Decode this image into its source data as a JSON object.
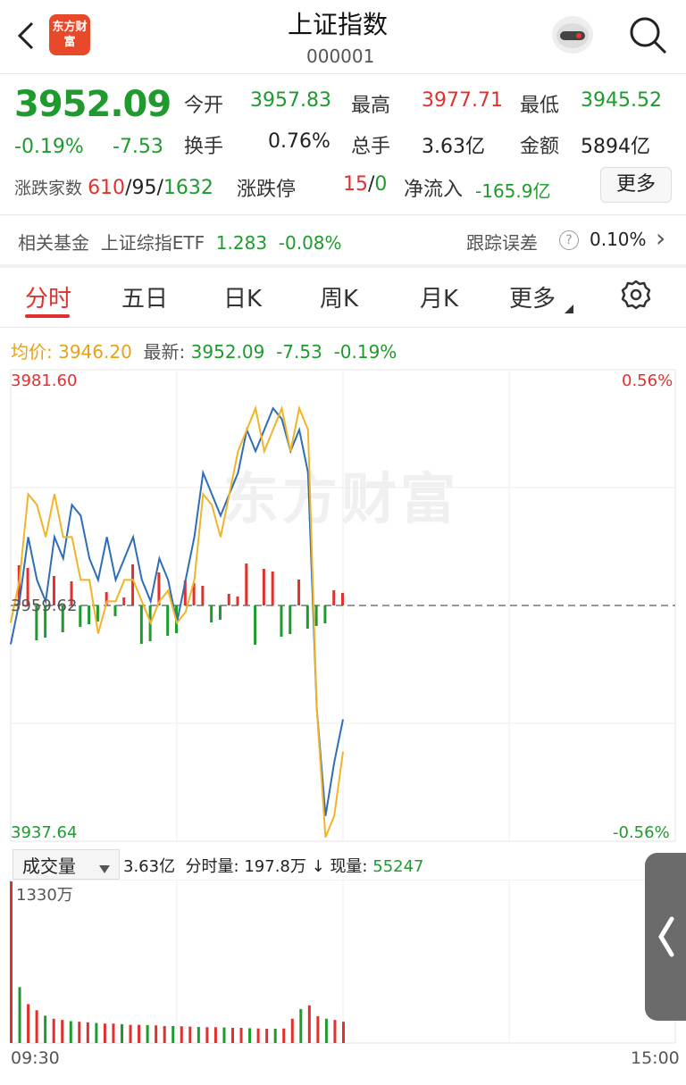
{
  "header": {
    "title": "上证指数",
    "code": "000001",
    "logo_text": "东方财富"
  },
  "quote": {
    "price": "3952.09",
    "change_pct": "-0.19%",
    "change": "-7.53",
    "stats": [
      {
        "label": "今开",
        "value": "3957.83",
        "color": "green"
      },
      {
        "label": "最高",
        "value": "3977.71",
        "color": "red"
      },
      {
        "label": "最低",
        "value": "3945.52",
        "color": "green"
      },
      {
        "label": "换手",
        "value": "0.76%",
        "color": "black"
      },
      {
        "label": "总手",
        "value": "3.63亿",
        "color": "black"
      },
      {
        "label": "金额",
        "value": "5894亿",
        "color": "black"
      }
    ],
    "breadth_label": "涨跌家数",
    "breadth_up": "610",
    "breadth_flat": "95",
    "breadth_down": "1632",
    "slash": "/",
    "limit_label": "涨跌停",
    "limit_up": "15",
    "limit_down": "0",
    "netflow_label": "净流入",
    "netflow_value": "-165.9亿",
    "more_label": "更多"
  },
  "fund_row": {
    "label": "相关基金",
    "fund_name": "上证综指ETF",
    "fund_price": "1.283",
    "fund_change": "-0.08%",
    "tracking_label": "跟踪误差",
    "help_icon": "?",
    "tracking_value": "0.10%",
    "chevron": "›"
  },
  "tabs": [
    "分时",
    "五日",
    "日K",
    "周K",
    "月K",
    "更多"
  ],
  "legend": {
    "avg_label": "均价:",
    "avg_value": "3946.20",
    "latest_label": "最新:",
    "latest_value": "3952.09",
    "latest_change": "-7.53",
    "latest_pct": "-0.19%"
  },
  "price_axis": {
    "top_price": "3981.60",
    "mid_price": "3959.62",
    "bottom_price": "3937.64",
    "top_pct": "0.56%",
    "bottom_pct": "-0.56%"
  },
  "watermark": "东方财富",
  "volume_bar": {
    "selector": "成交量",
    "total": "3.63亿",
    "minute_label": "分时量:",
    "minute_value": "197.8万",
    "down_arrow": "↓",
    "current_label": "现量:",
    "current_value": "55247",
    "max_label": "1330万"
  },
  "time_axis": {
    "start": "09:30",
    "end": "15:00"
  },
  "colors": {
    "up": "#e0312f",
    "down": "#1f9a2e",
    "price_line": "#2f6db5",
    "avg_line": "#f0b429"
  },
  "chart_data": {
    "type": "line",
    "ylim": [
      3937.64,
      3981.6
    ],
    "pre_close": 3959.62,
    "series": [
      {
        "values": [
          3956,
          3960,
          3966,
          3962,
          3960,
          3966,
          3964,
          3969,
          3968,
          3964,
          3962,
          3966,
          3962,
          3964,
          3966,
          3962,
          3960,
          3964,
          3962,
          3958,
          3962,
          3966,
          3972,
          3970,
          3968,
          3970,
          3972,
          3976,
          3974,
          3976,
          3978,
          3977,
          3974,
          3976,
          3972,
          3950,
          3940,
          3945,
          3949
        ]
      },
      {
        "values": [
          3958,
          3962,
          3970,
          3969,
          3966,
          3970,
          3966,
          3966,
          3962,
          3962,
          3957,
          3960,
          3960,
          3962,
          3962,
          3960,
          3958,
          3960,
          3961,
          3958,
          3959,
          3962,
          3970,
          3969,
          3966,
          3970,
          3974,
          3976,
          3978,
          3974,
          3976,
          3978,
          3974,
          3978,
          3976,
          3950,
          3938,
          3940,
          3946
        ]
      }
    ],
    "volume": [
      1330,
      460,
      320,
      270,
      225,
      200,
      190,
      180,
      175,
      170,
      165,
      160,
      160,
      155,
      150,
      150,
      148,
      145,
      140,
      140,
      138,
      135,
      132,
      130,
      130,
      128,
      125,
      125,
      122,
      120,
      118,
      118,
      120,
      200,
      280,
      310,
      220,
      200,
      190,
      175
    ]
  }
}
